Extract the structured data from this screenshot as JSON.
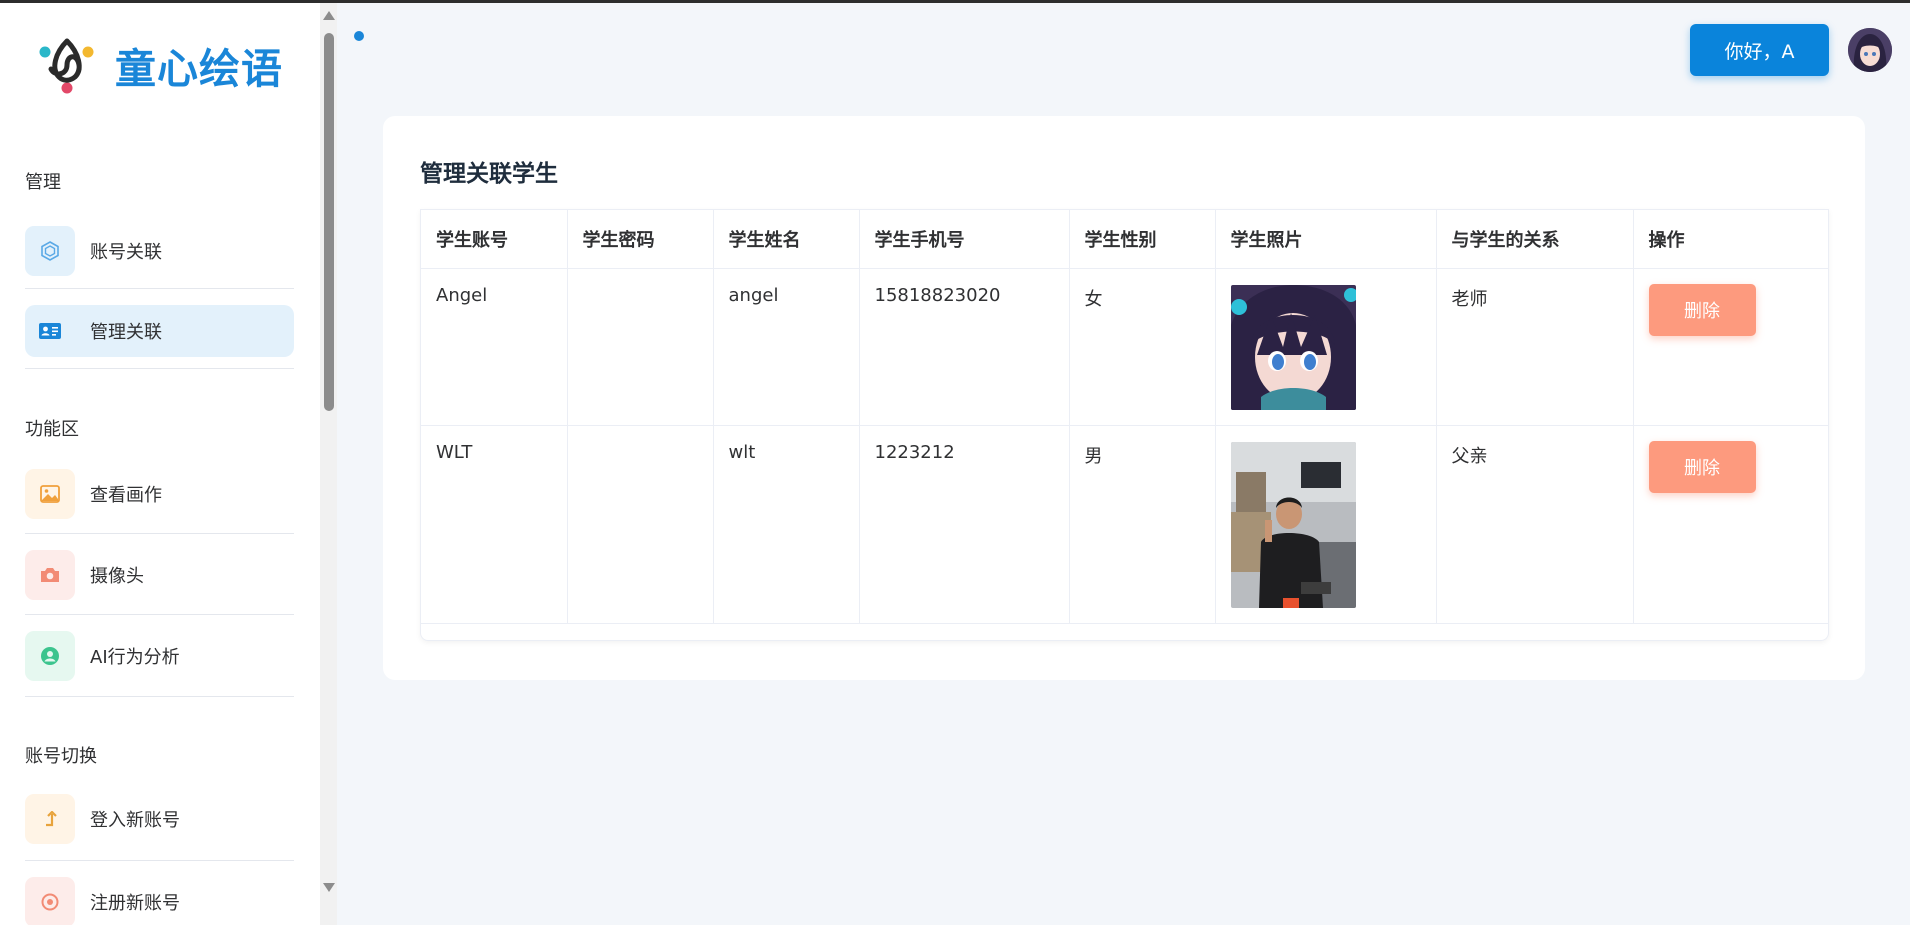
{
  "app": {
    "title": "童心绘语"
  },
  "sidebar": {
    "sections": [
      {
        "label": "管理"
      },
      {
        "label": "功能区"
      },
      {
        "label": "账号切换"
      }
    ],
    "items": [
      {
        "label": "账号关联",
        "icon": "link-hexagon-icon",
        "color": "#5aa9e6",
        "bg": "#e3f1fb"
      },
      {
        "label": "管理关联",
        "icon": "id-card-icon",
        "color": "#1a86d8",
        "bg": "#e3f1fb",
        "active": true
      },
      {
        "label": "查看画作",
        "icon": "image-icon",
        "color": "#f0a03c",
        "bg": "#fff4e6"
      },
      {
        "label": "摄像头",
        "icon": "camera-icon",
        "color": "#f28b75",
        "bg": "#fdecea"
      },
      {
        "label": "AI行为分析",
        "icon": "user-circle-icon",
        "color": "#3cc48e",
        "bg": "#e6f8f0"
      },
      {
        "label": "登入新账号",
        "icon": "login-arrow-icon",
        "color": "#e8a33c",
        "bg": "#fff4e6"
      },
      {
        "label": "注册新账号",
        "icon": "register-icon",
        "color": "#f28b75",
        "bg": "#fdecea"
      }
    ]
  },
  "header": {
    "greeting": "你好，A"
  },
  "card": {
    "title": "管理关联学生",
    "columns": [
      "学生账号",
      "学生密码",
      "学生姓名",
      "学生手机号",
      "学生性别",
      "学生照片",
      "与学生的关系",
      "操作"
    ],
    "rows": [
      {
        "account": "Angel",
        "password": "",
        "name": "angel",
        "phone": "15818823020",
        "gender": "女",
        "relation": "老师",
        "action": "删除"
      },
      {
        "account": "WLT",
        "password": "",
        "name": "wlt",
        "phone": "1223212",
        "gender": "男",
        "relation": "父亲",
        "action": "删除"
      }
    ]
  },
  "colors": {
    "accent": "#0a84db",
    "danger": "#fd9a7e"
  }
}
